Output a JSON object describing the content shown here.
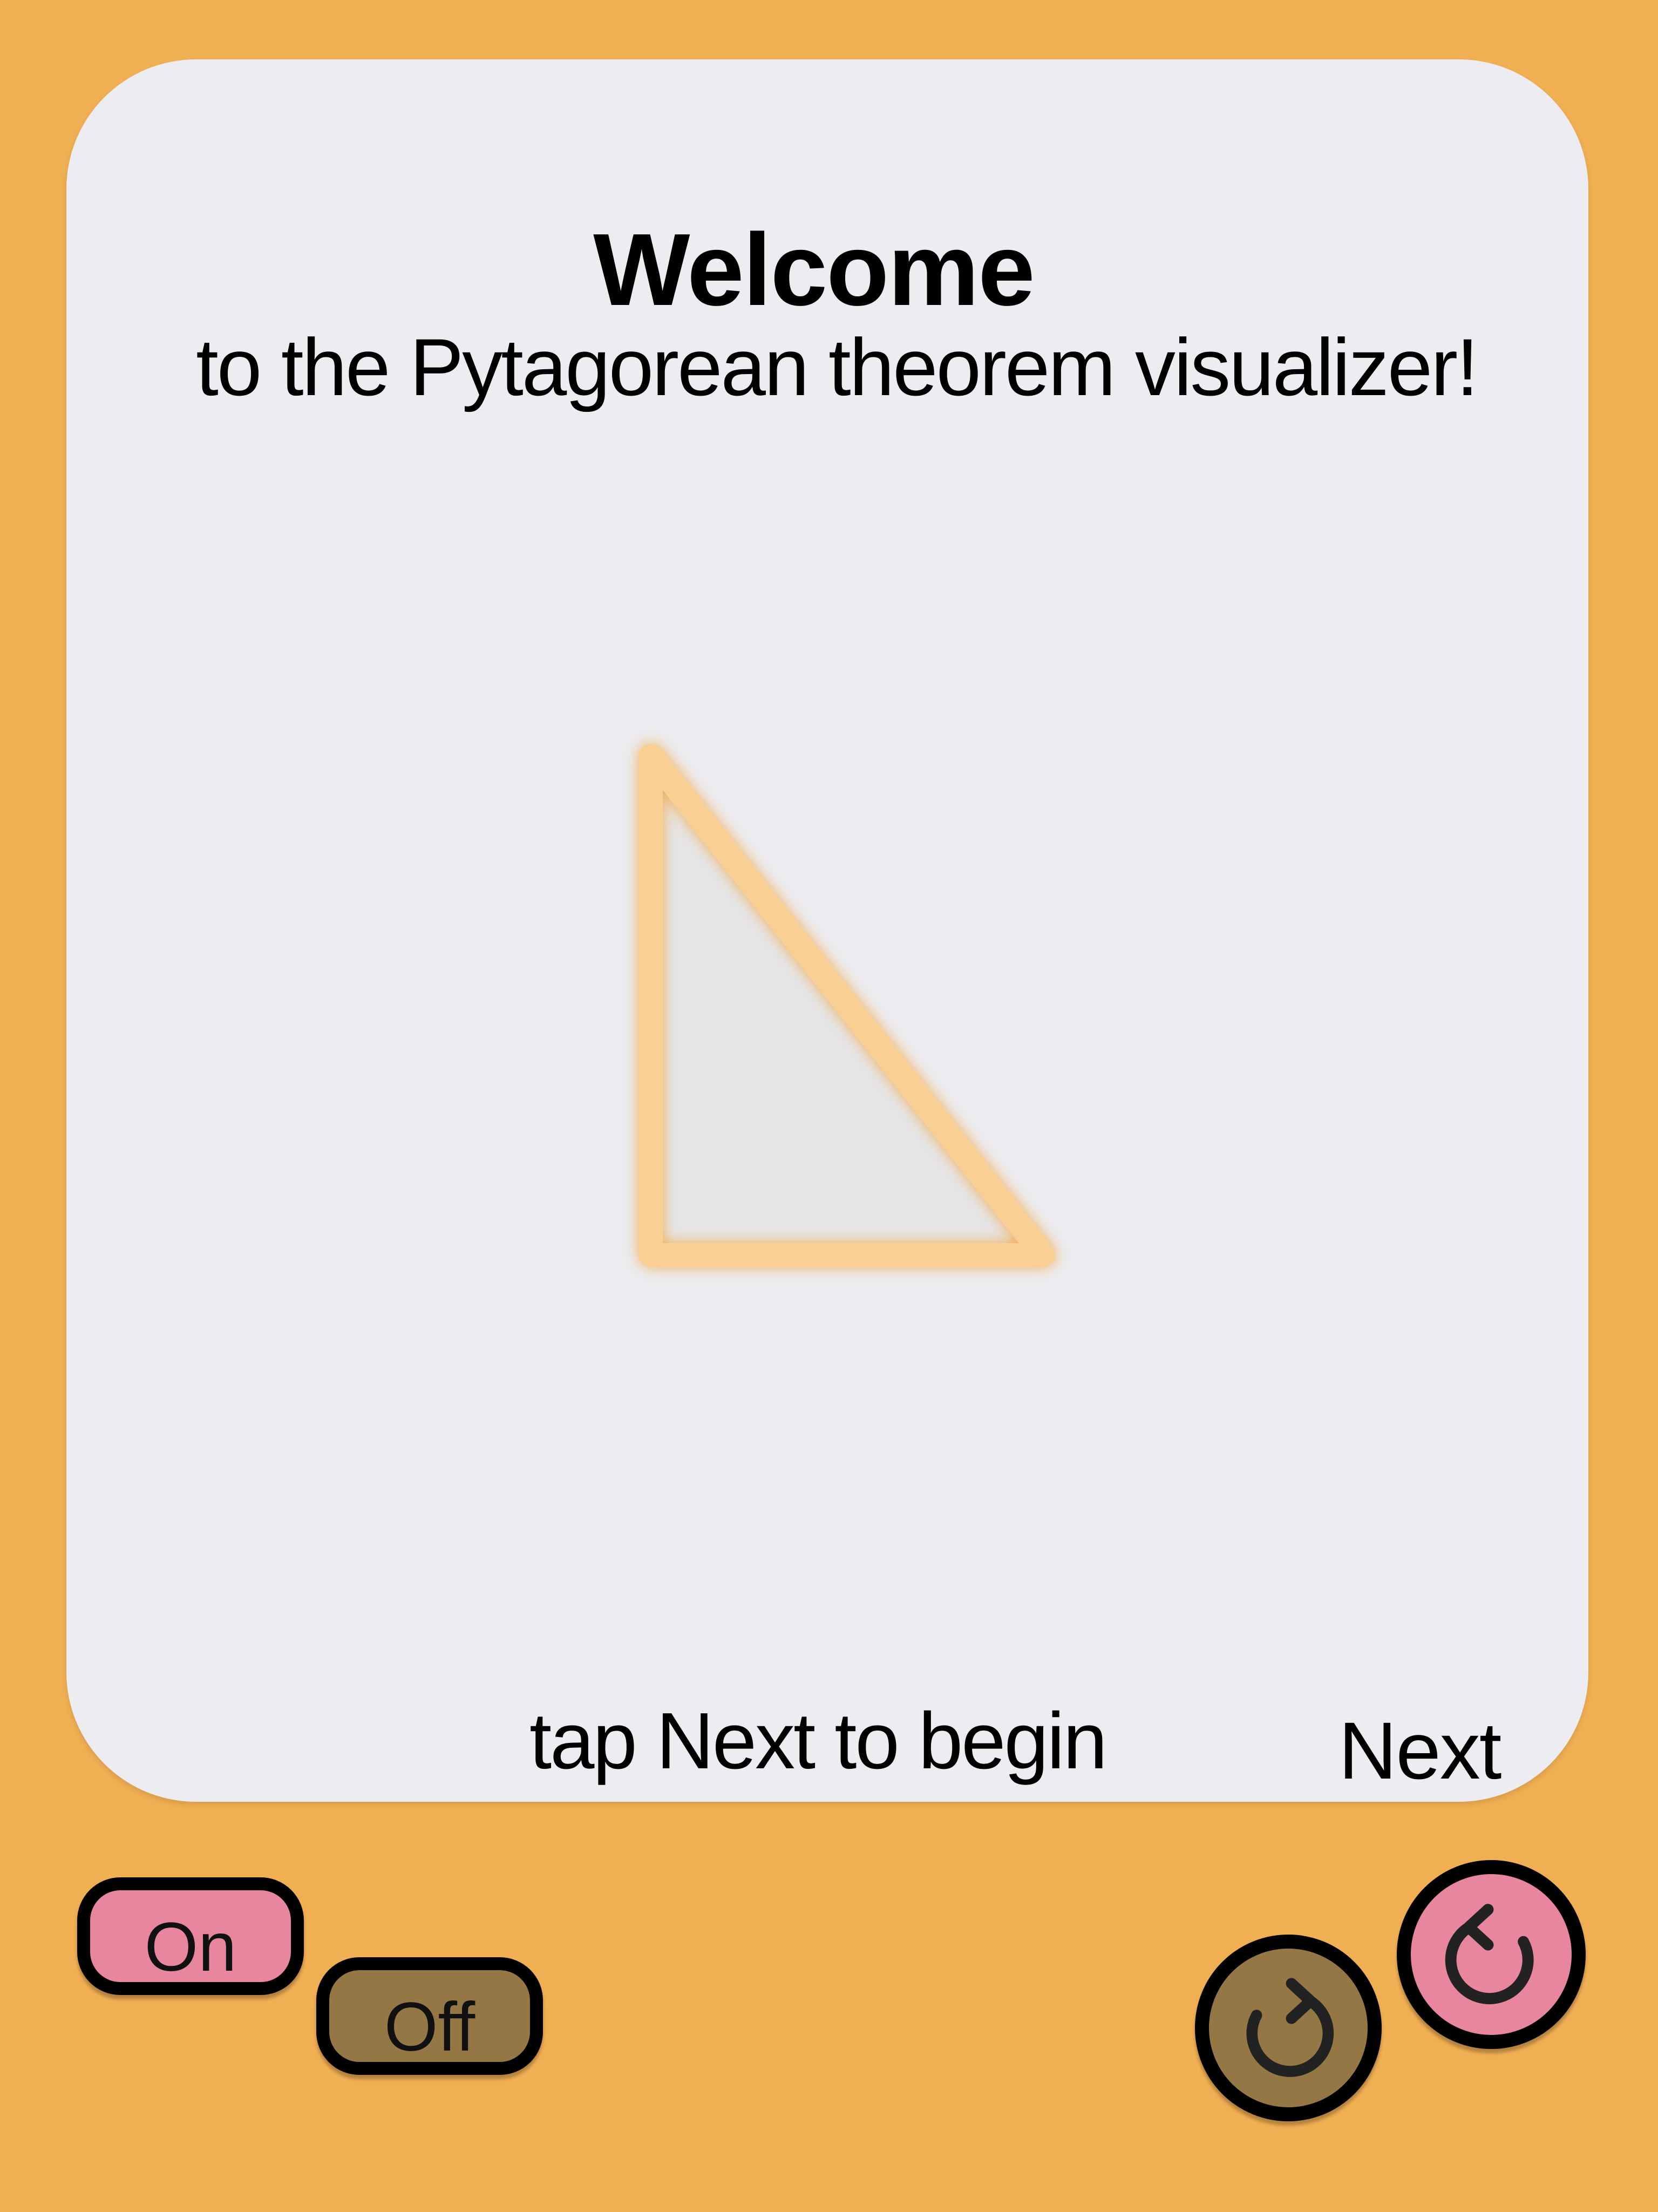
{
  "welcome": {
    "title": "Welcome",
    "subtitle": "to the Pytagorean theorem visualizer!",
    "hint": "tap Next to begin",
    "next_label": "Next"
  },
  "controls": {
    "on_label": "On",
    "off_label": "Off",
    "redo_icon": "redo-icon",
    "undo_icon": "undo-icon"
  },
  "colors": {
    "background": "#F1AF53",
    "card": "#ECECF1",
    "on_pill": "#E9869F",
    "off_pill": "#947745",
    "triangle_stroke": "#F9CF93",
    "triangle_fill": "#E5E5E8"
  }
}
